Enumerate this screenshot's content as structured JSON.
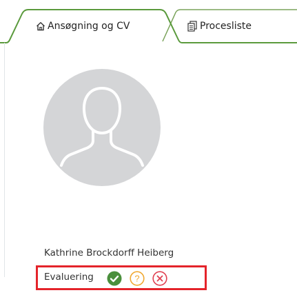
{
  "tabs": [
    {
      "label": "Ansøgning og CV",
      "icon": "home-icon",
      "active": true
    },
    {
      "label": "Procesliste",
      "icon": "documents-icon",
      "active": false
    }
  ],
  "candidate": {
    "name": "Kathrine Brockdorff Heiberg",
    "avatar_icon": "user-silhouette-icon"
  },
  "evaluation": {
    "label": "Evaluering",
    "options": [
      {
        "name": "approve",
        "icon": "checkmark-icon",
        "color": "#4a8f3c"
      },
      {
        "name": "maybe",
        "icon": "question-icon",
        "color": "#f0a830"
      },
      {
        "name": "reject",
        "icon": "close-icon",
        "color": "#e04050"
      }
    ],
    "highlight_color": "#e4232a"
  },
  "colors": {
    "tab_border": "#5a9a3c",
    "tab_inactive_border": "#7aa35a",
    "avatar_bg": "#d4d5d7"
  }
}
